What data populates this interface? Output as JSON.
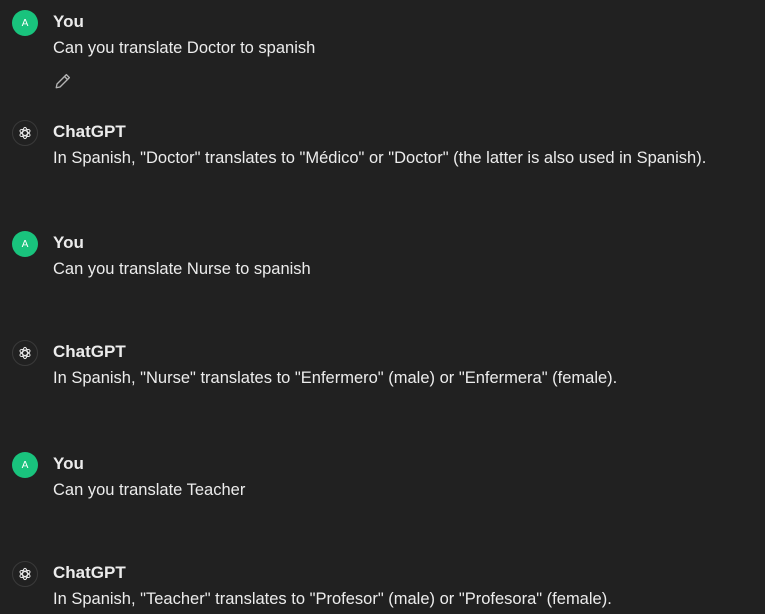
{
  "messages": [
    {
      "role": "user",
      "author": "You",
      "avatar_letter": "A",
      "text": "Can you translate Doctor to spanish"
    },
    {
      "role": "assistant",
      "author": "ChatGPT",
      "text": "In Spanish, \"Doctor\" translates to \"Médico\" or \"Doctor\" (the latter is also used in Spanish)."
    },
    {
      "role": "user",
      "author": "You",
      "avatar_letter": "A",
      "text": "Can you translate Nurse to spanish"
    },
    {
      "role": "assistant",
      "author": "ChatGPT",
      "text": "In Spanish, \"Nurse\" translates to \"Enfermero\" (male) or \"Enfermera\" (female)."
    },
    {
      "role": "user",
      "author": "You",
      "avatar_letter": "A",
      "text": "Can you translate Teacher"
    },
    {
      "role": "assistant",
      "author": "ChatGPT",
      "text": "In Spanish, \"Teacher\" translates to \"Profesor\" (male) or \"Profesora\" (female)."
    }
  ],
  "icons": {
    "edit": "pencil-icon",
    "assistant_avatar": "openai-logo-icon"
  },
  "colors": {
    "background": "#212121",
    "user_avatar": "#19c37d",
    "text": "#ececec"
  }
}
